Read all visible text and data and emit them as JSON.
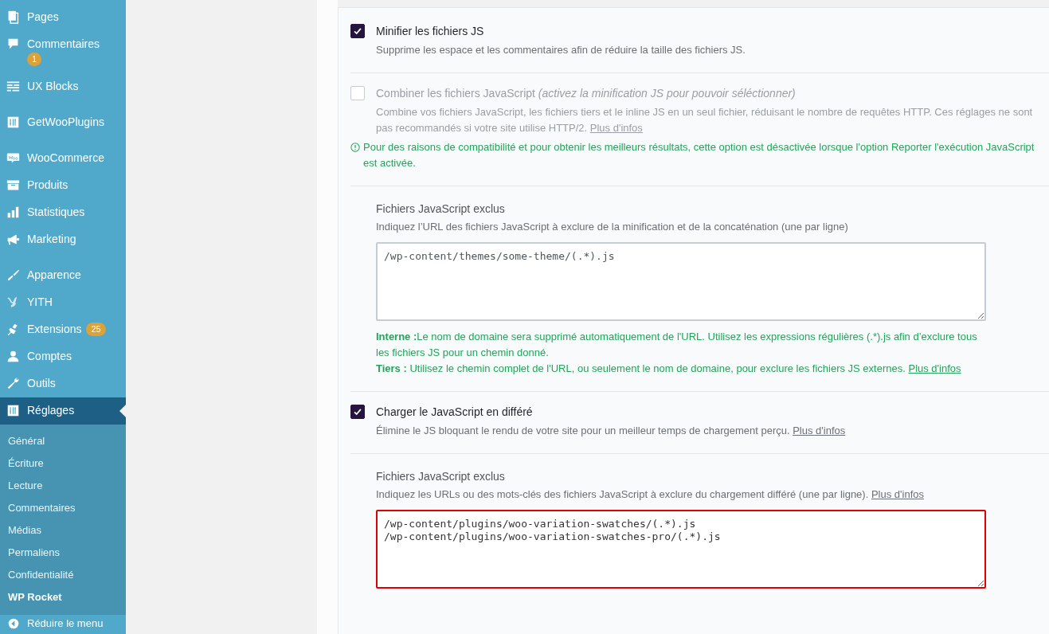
{
  "sidebar": {
    "items": [
      {
        "label": "Pages",
        "selected": false
      },
      {
        "label": "Commentaires",
        "badge": "1",
        "selected": false
      },
      {
        "label": "UX Blocks",
        "selected": false
      },
      {
        "label": "GetWooPlugins",
        "selected": false
      },
      {
        "label": "WooCommerce",
        "selected": false
      },
      {
        "label": "Produits",
        "selected": false
      },
      {
        "label": "Statistiques",
        "selected": false
      },
      {
        "label": "Marketing",
        "selected": false
      },
      {
        "label": "Apparence",
        "selected": false
      },
      {
        "label": "YITH",
        "selected": false
      },
      {
        "label": "Extensions",
        "badge": "25",
        "selected": false
      },
      {
        "label": "Comptes",
        "selected": false
      },
      {
        "label": "Outils",
        "selected": false
      },
      {
        "label": "Réglages",
        "selected": true
      }
    ],
    "submenu": [
      {
        "label": "Général",
        "selected": false
      },
      {
        "label": "Écriture",
        "selected": false
      },
      {
        "label": "Lecture",
        "selected": false
      },
      {
        "label": "Commentaires",
        "selected": false
      },
      {
        "label": "Médias",
        "selected": false
      },
      {
        "label": "Permaliens",
        "selected": false
      },
      {
        "label": "Confidentialité",
        "selected": false
      },
      {
        "label": "WP Rocket",
        "selected": true
      }
    ],
    "collapse_label": "Réduire le menu"
  },
  "options": [
    {
      "kind": "checkbox",
      "label": "Minifier les fichiers JS",
      "checked": true,
      "disabled": false,
      "description": "Supprime les espace et les commentaires afin de réduire la taille des fichiers JS."
    },
    {
      "kind": "checkbox",
      "label": "Combiner les fichiers JavaScript",
      "label_note": "(activez la minification JS pour pouvoir séléctionner)",
      "checked": false,
      "disabled": true,
      "description": "Combine vos fichiers JavaScript, les fichiers tiers et le inline JS en un seul fichier, réduisant le nombre de requêtes HTTP. Ces réglages ne sont pas recommandés si votre site utilise HTTP/2.",
      "link": "Plus d'infos",
      "warning": "Pour des raisons de compatibilité et pour obtenir les meilleurs résultats, cette option est désactivée lorsque l'option Reporter l'exécution JavaScript est activée."
    },
    {
      "kind": "textarea",
      "title": "Fichiers JavaScript exclus",
      "description": "Indiquez l’URL des fichiers JavaScript à exclure de la minification et de la concaténation (une par ligne)",
      "placeholder": "/wp-content/themes/some-theme/(.*).js",
      "highlighted": false,
      "notes": [
        {
          "text": "**Interne :**Le nom de domaine sera supprimé automatiquement de l'URL. Utilisez les expressions régulières (.*).js afin d’exclure tous les fichiers JS pour un chemin donné."
        },
        {
          "text": "**Tiers :** Utilisez le chemin complet de l'URL, ou seulement le nom de domaine, pour exclure les fichiers JS externes.",
          "link": "Plus d'infos"
        }
      ]
    },
    {
      "kind": "checkbox",
      "label": "Charger le JavaScript en différé",
      "checked": true,
      "disabled": false,
      "description": "Élimine le JS bloquant le rendu de votre site pour un meilleur temps de chargement perçu.",
      "link": "Plus d'infos"
    },
    {
      "kind": "textarea",
      "title": "Fichiers JavaScript exclus",
      "description": "Indiquez les URLs ou des mots-clés des fichiers JavaScript à exclure du chargement différé (une par ligne).",
      "link": "Plus d'infos",
      "value": "/wp-content/plugins/woo-variation-swatches/(.*).js\n/wp-content/plugins/woo-variation-swatches-pro/(.*).js",
      "highlighted": true
    }
  ]
}
